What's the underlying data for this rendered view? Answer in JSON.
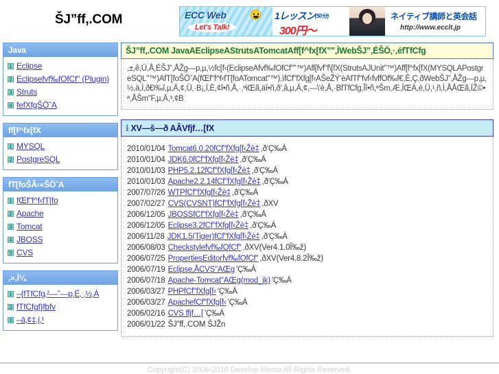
{
  "header": {
    "site_title": "ŠJ”ff,.COM",
    "banner": {
      "brand": "ECC Web",
      "smiley_icon": "smiley-face-icon",
      "tagline": "Let's Talk!",
      "lesson": "1レッスン",
      "lesson_duration": "(50分)",
      "price": "300円〜",
      "catch": "ネイティブ講師と英会話",
      "url": "http://www.ecclt.jp"
    }
  },
  "sidebar": {
    "boxes": [
      {
        "title": "Java",
        "items": [
          {
            "num": "1",
            "label": "Eclipse"
          },
          {
            "num": "2",
            "label": "Eclipsefvf‰fOfCf\" (Plugin)"
          },
          {
            "num": "3",
            "label": "Struts"
          },
          {
            "num": "4",
            "label": "fefXfgŠÖ˜A"
          }
        ]
      },
      {
        "title": "ff[f^fx[fX",
        "items": [
          {
            "num": "1",
            "label": "MYSQL"
          },
          {
            "num": "2",
            "label": "PostgreSQL"
          }
        ]
      },
      {
        "title": "fT[foŠÃ‹«ŠÖ˜A",
        "items": [
          {
            "num": "1",
            "label": "fŒf\"f^f‹fT[fo"
          },
          {
            "num": "2",
            "label": "Apache"
          },
          {
            "num": "3",
            "label": "Tomcat"
          },
          {
            "num": "4",
            "label": "JBOSS"
          },
          {
            "num": "5",
            "label": "CVS"
          }
        ]
      },
      {
        "title": ",»,Ì¼",
        "items": [
          {
            "num": "1",
            "label": "–{fTfCfg‚²—˜—p‚É‚ ‚½‚Á"
          },
          {
            "num": "2",
            "label": "fTfCfgf}fbfv"
          },
          {
            "num": "3",
            "label": "–â‚¢‡‚í‚¹"
          }
        ]
      }
    ]
  },
  "main": {
    "title_bar": "ŠJ”ff,.COM JavaAEclipseAStrutsATomcatAff[f^fx[fX”\",ÌWebŠJ”,ÉŠÖ‚·‚éfTfCfg",
    "intro": ",±,ê,Ü,Å,ÉŠJ”,ÅŽg—p,µ,½fc[f‹(EclipseAfvf‰fOfCf\"\"™)Afl[fvf\"f\\[fX(StrutsAJUnit\"™)Aff[f^fx[fX(MYSQLAPostgreSQL\"™)AfT[foŠÖ˜A(fŒf\"f^f‹fT[foATomcat\"™),ìfCf\"fXfg[f‹AŠeŽÝ‘èAfTf\"fvf‹fvffOf‰f€,È,Ç,ðWebŠJ”,ÅŽg—p,µ,½,à,Ì,ðÐ‰î,µ,Ä,¢,Ü,·B¡,Í,È,¢î•ñ,Å,·,ªiŒã,äî•ñ,ð',â,µ,Ä,¢,—\\'è,Å,·BfTfCfg,Îî•ñ,ªŠm,Æ,ÍŒÀ,è,Ü,¹,ñ,Ì,ÅÅŒã,ÍŽ©•ª,ÅŠm\"F,µ,Ä,³,¢B",
    "section_title": "XV—š—ð AÂVfjf…[fX",
    "info_icon": "info-icon",
    "news": [
      {
        "date": "2010/01/04",
        "link": "Tomcat6.0.20fCf\"fXfg[f‹Žè‡",
        "tail": ",ð'Ç‰Á"
      },
      {
        "date": "2010/01/04",
        "link": "JDK6.0fCf\"fXfg[f‹Žè‡",
        "tail": ",ð'Ç‰Á"
      },
      {
        "date": "2010/01/03",
        "link": "PHP5.2.12fCf\"fXfg[f‹Žè‡",
        "tail": ",ð'Ç‰Á"
      },
      {
        "date": "2010/01/03",
        "link": "Apache2.2.14fCf\"fXfg[f‹Žè‡",
        "tail": ",ð'Ç‰Á"
      },
      {
        "date": "2007/07/26",
        "link": "WTPfCf\"fXfg[f‹Žè‡",
        "tail": ",ð'Ç‰Á"
      },
      {
        "date": "2007/02/27",
        "link": "CVS(CVSNT)fCf\"fXfg[f‹Žè‡",
        "tail": ",ðXV"
      },
      {
        "date": "2006/12/05",
        "link": "JBOSSfCf\"fXfg[f‹Žè‡",
        "tail": ",ð'Ç‰Á"
      },
      {
        "date": "2006/12/05",
        "link": "Eclipse3.2fCf\"fXfg[f‹Žè‡",
        "tail": ",ð'Ç‰Á"
      },
      {
        "date": "2006/11/28",
        "link": "JDK1.5(Tiger)fCf\"fXfg[f‹Žè‡",
        "tail": ",ð'Ç‰Á"
      },
      {
        "date": "2006/08/03",
        "link": "Checkstylefvf‰fOfCf\"",
        "tail": ",ðXV(Ver4.1.0Î‰ž)"
      },
      {
        "date": "2006/07/25",
        "link": "PropertiesEditorfvf‰fOfCf\"",
        "tail": ",ðXV(Ver4.8.2Î‰ž)"
      },
      {
        "date": "2006/07/19",
        "link": "Eclipse‚ÅCVS\"AŒg",
        "tail": "'Ç‰Á"
      },
      {
        "date": "2006/07/18",
        "link": "Apache-Tomcat\"AŒg(mod_jk)",
        "tail": "'Ç‰Á"
      },
      {
        "date": "2006/03/27",
        "link": "PHPfCf\"fXfg[f‹",
        "tail": "'Ç‰Á"
      },
      {
        "date": "2006/03/27",
        "link": "ApachefCf\"fXfg[f‹",
        "tail": "'Ç‰Á"
      },
      {
        "date": "2006/02/16",
        "link": "CVS ffjf…[",
        "tail": "'Ç‰Á"
      },
      {
        "date": "2006/01/22",
        "plain": "ŠJ”ff,.COM ŠJŽn"
      }
    ]
  },
  "footer": {
    "copyright": "Copyright(C) 2006-2010 Develop-Memo All Rights Reserved."
  }
}
